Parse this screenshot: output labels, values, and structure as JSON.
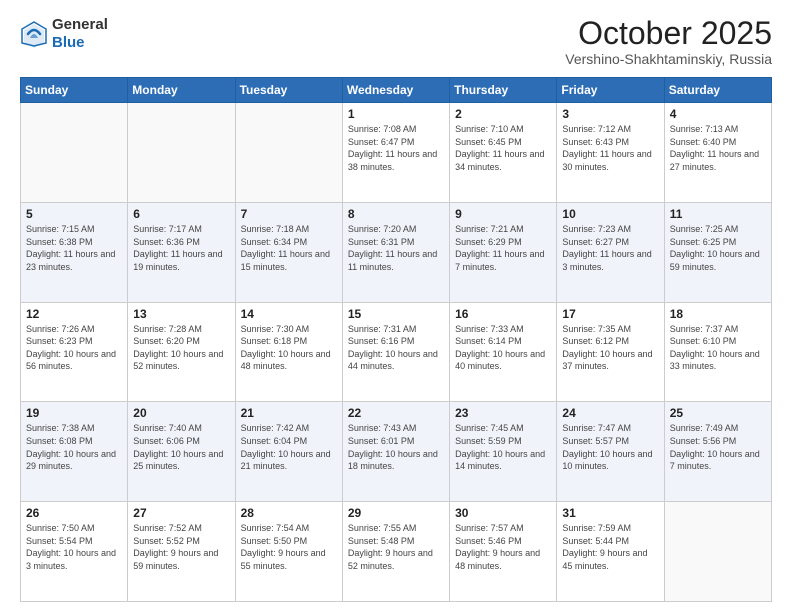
{
  "header": {
    "logo": {
      "line1": "General",
      "line2": "Blue"
    },
    "title": "October 2025",
    "location": "Vershino-Shakhtaminskiy, Russia"
  },
  "days_of_week": [
    "Sunday",
    "Monday",
    "Tuesday",
    "Wednesday",
    "Thursday",
    "Friday",
    "Saturday"
  ],
  "weeks": [
    [
      {
        "day": "",
        "sunrise": "",
        "sunset": "",
        "daylight": ""
      },
      {
        "day": "",
        "sunrise": "",
        "sunset": "",
        "daylight": ""
      },
      {
        "day": "",
        "sunrise": "",
        "sunset": "",
        "daylight": ""
      },
      {
        "day": "1",
        "sunrise": "Sunrise: 7:08 AM",
        "sunset": "Sunset: 6:47 PM",
        "daylight": "Daylight: 11 hours and 38 minutes."
      },
      {
        "day": "2",
        "sunrise": "Sunrise: 7:10 AM",
        "sunset": "Sunset: 6:45 PM",
        "daylight": "Daylight: 11 hours and 34 minutes."
      },
      {
        "day": "3",
        "sunrise": "Sunrise: 7:12 AM",
        "sunset": "Sunset: 6:43 PM",
        "daylight": "Daylight: 11 hours and 30 minutes."
      },
      {
        "day": "4",
        "sunrise": "Sunrise: 7:13 AM",
        "sunset": "Sunset: 6:40 PM",
        "daylight": "Daylight: 11 hours and 27 minutes."
      }
    ],
    [
      {
        "day": "5",
        "sunrise": "Sunrise: 7:15 AM",
        "sunset": "Sunset: 6:38 PM",
        "daylight": "Daylight: 11 hours and 23 minutes."
      },
      {
        "day": "6",
        "sunrise": "Sunrise: 7:17 AM",
        "sunset": "Sunset: 6:36 PM",
        "daylight": "Daylight: 11 hours and 19 minutes."
      },
      {
        "day": "7",
        "sunrise": "Sunrise: 7:18 AM",
        "sunset": "Sunset: 6:34 PM",
        "daylight": "Daylight: 11 hours and 15 minutes."
      },
      {
        "day": "8",
        "sunrise": "Sunrise: 7:20 AM",
        "sunset": "Sunset: 6:31 PM",
        "daylight": "Daylight: 11 hours and 11 minutes."
      },
      {
        "day": "9",
        "sunrise": "Sunrise: 7:21 AM",
        "sunset": "Sunset: 6:29 PM",
        "daylight": "Daylight: 11 hours and 7 minutes."
      },
      {
        "day": "10",
        "sunrise": "Sunrise: 7:23 AM",
        "sunset": "Sunset: 6:27 PM",
        "daylight": "Daylight: 11 hours and 3 minutes."
      },
      {
        "day": "11",
        "sunrise": "Sunrise: 7:25 AM",
        "sunset": "Sunset: 6:25 PM",
        "daylight": "Daylight: 10 hours and 59 minutes."
      }
    ],
    [
      {
        "day": "12",
        "sunrise": "Sunrise: 7:26 AM",
        "sunset": "Sunset: 6:23 PM",
        "daylight": "Daylight: 10 hours and 56 minutes."
      },
      {
        "day": "13",
        "sunrise": "Sunrise: 7:28 AM",
        "sunset": "Sunset: 6:20 PM",
        "daylight": "Daylight: 10 hours and 52 minutes."
      },
      {
        "day": "14",
        "sunrise": "Sunrise: 7:30 AM",
        "sunset": "Sunset: 6:18 PM",
        "daylight": "Daylight: 10 hours and 48 minutes."
      },
      {
        "day": "15",
        "sunrise": "Sunrise: 7:31 AM",
        "sunset": "Sunset: 6:16 PM",
        "daylight": "Daylight: 10 hours and 44 minutes."
      },
      {
        "day": "16",
        "sunrise": "Sunrise: 7:33 AM",
        "sunset": "Sunset: 6:14 PM",
        "daylight": "Daylight: 10 hours and 40 minutes."
      },
      {
        "day": "17",
        "sunrise": "Sunrise: 7:35 AM",
        "sunset": "Sunset: 6:12 PM",
        "daylight": "Daylight: 10 hours and 37 minutes."
      },
      {
        "day": "18",
        "sunrise": "Sunrise: 7:37 AM",
        "sunset": "Sunset: 6:10 PM",
        "daylight": "Daylight: 10 hours and 33 minutes."
      }
    ],
    [
      {
        "day": "19",
        "sunrise": "Sunrise: 7:38 AM",
        "sunset": "Sunset: 6:08 PM",
        "daylight": "Daylight: 10 hours and 29 minutes."
      },
      {
        "day": "20",
        "sunrise": "Sunrise: 7:40 AM",
        "sunset": "Sunset: 6:06 PM",
        "daylight": "Daylight: 10 hours and 25 minutes."
      },
      {
        "day": "21",
        "sunrise": "Sunrise: 7:42 AM",
        "sunset": "Sunset: 6:04 PM",
        "daylight": "Daylight: 10 hours and 21 minutes."
      },
      {
        "day": "22",
        "sunrise": "Sunrise: 7:43 AM",
        "sunset": "Sunset: 6:01 PM",
        "daylight": "Daylight: 10 hours and 18 minutes."
      },
      {
        "day": "23",
        "sunrise": "Sunrise: 7:45 AM",
        "sunset": "Sunset: 5:59 PM",
        "daylight": "Daylight: 10 hours and 14 minutes."
      },
      {
        "day": "24",
        "sunrise": "Sunrise: 7:47 AM",
        "sunset": "Sunset: 5:57 PM",
        "daylight": "Daylight: 10 hours and 10 minutes."
      },
      {
        "day": "25",
        "sunrise": "Sunrise: 7:49 AM",
        "sunset": "Sunset: 5:56 PM",
        "daylight": "Daylight: 10 hours and 7 minutes."
      }
    ],
    [
      {
        "day": "26",
        "sunrise": "Sunrise: 7:50 AM",
        "sunset": "Sunset: 5:54 PM",
        "daylight": "Daylight: 10 hours and 3 minutes."
      },
      {
        "day": "27",
        "sunrise": "Sunrise: 7:52 AM",
        "sunset": "Sunset: 5:52 PM",
        "daylight": "Daylight: 9 hours and 59 minutes."
      },
      {
        "day": "28",
        "sunrise": "Sunrise: 7:54 AM",
        "sunset": "Sunset: 5:50 PM",
        "daylight": "Daylight: 9 hours and 55 minutes."
      },
      {
        "day": "29",
        "sunrise": "Sunrise: 7:55 AM",
        "sunset": "Sunset: 5:48 PM",
        "daylight": "Daylight: 9 hours and 52 minutes."
      },
      {
        "day": "30",
        "sunrise": "Sunrise: 7:57 AM",
        "sunset": "Sunset: 5:46 PM",
        "daylight": "Daylight: 9 hours and 48 minutes."
      },
      {
        "day": "31",
        "sunrise": "Sunrise: 7:59 AM",
        "sunset": "Sunset: 5:44 PM",
        "daylight": "Daylight: 9 hours and 45 minutes."
      },
      {
        "day": "",
        "sunrise": "",
        "sunset": "",
        "daylight": ""
      }
    ]
  ]
}
